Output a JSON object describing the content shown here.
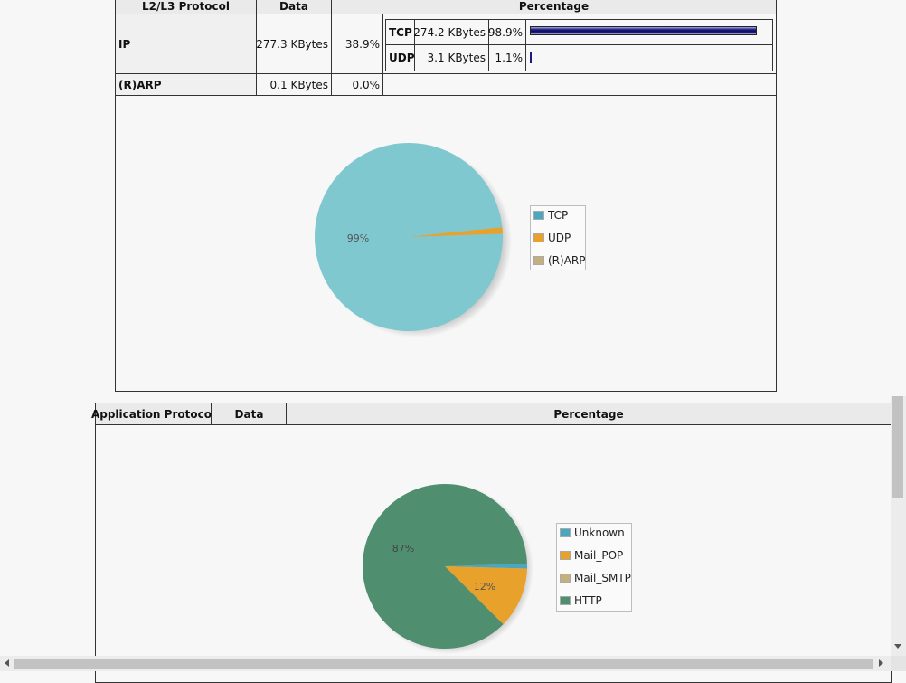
{
  "l23": {
    "headers": {
      "protocol": "L2/L3 Protocol",
      "data": "Data",
      "percentage": "Percentage"
    },
    "rows": [
      {
        "protocol": "IP",
        "data": "277.3 KBytes",
        "pct": "38.9%"
      },
      {
        "protocol": "(R)ARP",
        "data": "0.1 KBytes",
        "pct": "0.0%"
      }
    ],
    "subrows": [
      {
        "protocol": "TCP",
        "data": "274.2 KBytes",
        "pct": "98.9%",
        "fraction": 0.989
      },
      {
        "protocol": "UDP",
        "data": "3.1 KBytes",
        "pct": "1.1%",
        "fraction": 0.011
      }
    ]
  },
  "chart1": {
    "slice_label": "99%",
    "legend": [
      {
        "label": "TCP",
        "color": "#4aa7c0"
      },
      {
        "label": "UDP",
        "color": "#e8a12b"
      },
      {
        "label": "(R)ARP",
        "color": "#c3b07c"
      }
    ]
  },
  "app": {
    "headers": {
      "protocol": "Application Protocol",
      "data": "Data",
      "percentage": "Percentage"
    }
  },
  "chart2": {
    "labels": {
      "http": "87%",
      "mail_pop": "12%"
    },
    "legend": [
      {
        "label": "Unknown",
        "color": "#4aa7c0"
      },
      {
        "label": "Mail_POP",
        "color": "#e8a12b"
      },
      {
        "label": "Mail_SMTP",
        "color": "#c3b07c"
      },
      {
        "label": "HTTP",
        "color": "#4f8f6f"
      }
    ]
  },
  "chart_data": [
    {
      "type": "pie",
      "categories": [
        "TCP",
        "UDP",
        "(R)ARP"
      ],
      "values": [
        98.9,
        1.1,
        0.0
      ],
      "slice_labels": [
        "99%",
        "",
        ""
      ],
      "legend_position": "right"
    },
    {
      "type": "pie",
      "categories": [
        "Unknown",
        "Mail_POP",
        "Mail_SMTP",
        "HTTP"
      ],
      "values": [
        1,
        12,
        0,
        87
      ],
      "slice_labels": [
        "",
        "12%",
        "",
        "87%"
      ],
      "legend_position": "right"
    }
  ]
}
